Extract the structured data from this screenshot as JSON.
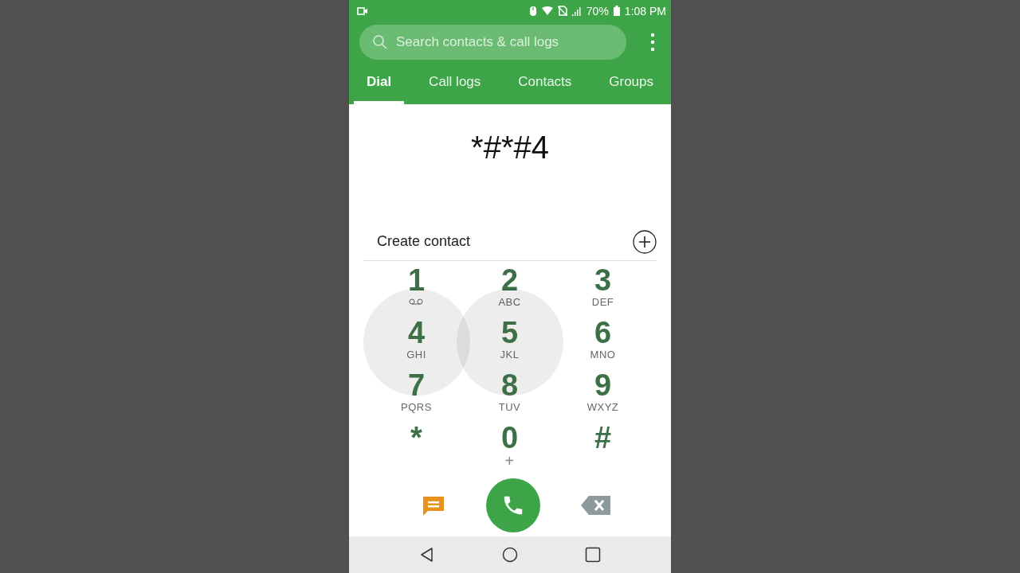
{
  "status_bar": {
    "battery": "70%",
    "time": "1:08 PM"
  },
  "search": {
    "placeholder": "Search contacts & call logs"
  },
  "tabs": [
    {
      "label": "Dial",
      "selected": true
    },
    {
      "label": "Call logs",
      "selected": false
    },
    {
      "label": "Contacts",
      "selected": false
    },
    {
      "label": "Groups",
      "selected": false
    }
  ],
  "dialed_number": "*#*#4",
  "create_contact": {
    "label": "Create contact"
  },
  "keypad": [
    {
      "digit": "1",
      "kind": "voicemail",
      "pressed": false
    },
    {
      "digit": "2",
      "kind": "letters",
      "letters": "ABC",
      "pressed": false
    },
    {
      "digit": "3",
      "kind": "letters",
      "letters": "DEF",
      "pressed": false
    },
    {
      "digit": "4",
      "kind": "letters",
      "letters": "GHI",
      "pressed": true
    },
    {
      "digit": "5",
      "kind": "letters",
      "letters": "JKL",
      "pressed": true
    },
    {
      "digit": "6",
      "kind": "letters",
      "letters": "MNO",
      "pressed": false
    },
    {
      "digit": "7",
      "kind": "letters",
      "letters": "PQRS",
      "pressed": false
    },
    {
      "digit": "8",
      "kind": "letters",
      "letters": "TUV",
      "pressed": false
    },
    {
      "digit": "9",
      "kind": "letters",
      "letters": "WXYZ",
      "pressed": false
    },
    {
      "digit": "*",
      "kind": "plain",
      "pressed": false
    },
    {
      "digit": "0",
      "kind": "letters",
      "letters": "+",
      "pressed": false
    },
    {
      "digit": "#",
      "kind": "plain",
      "pressed": false
    }
  ]
}
